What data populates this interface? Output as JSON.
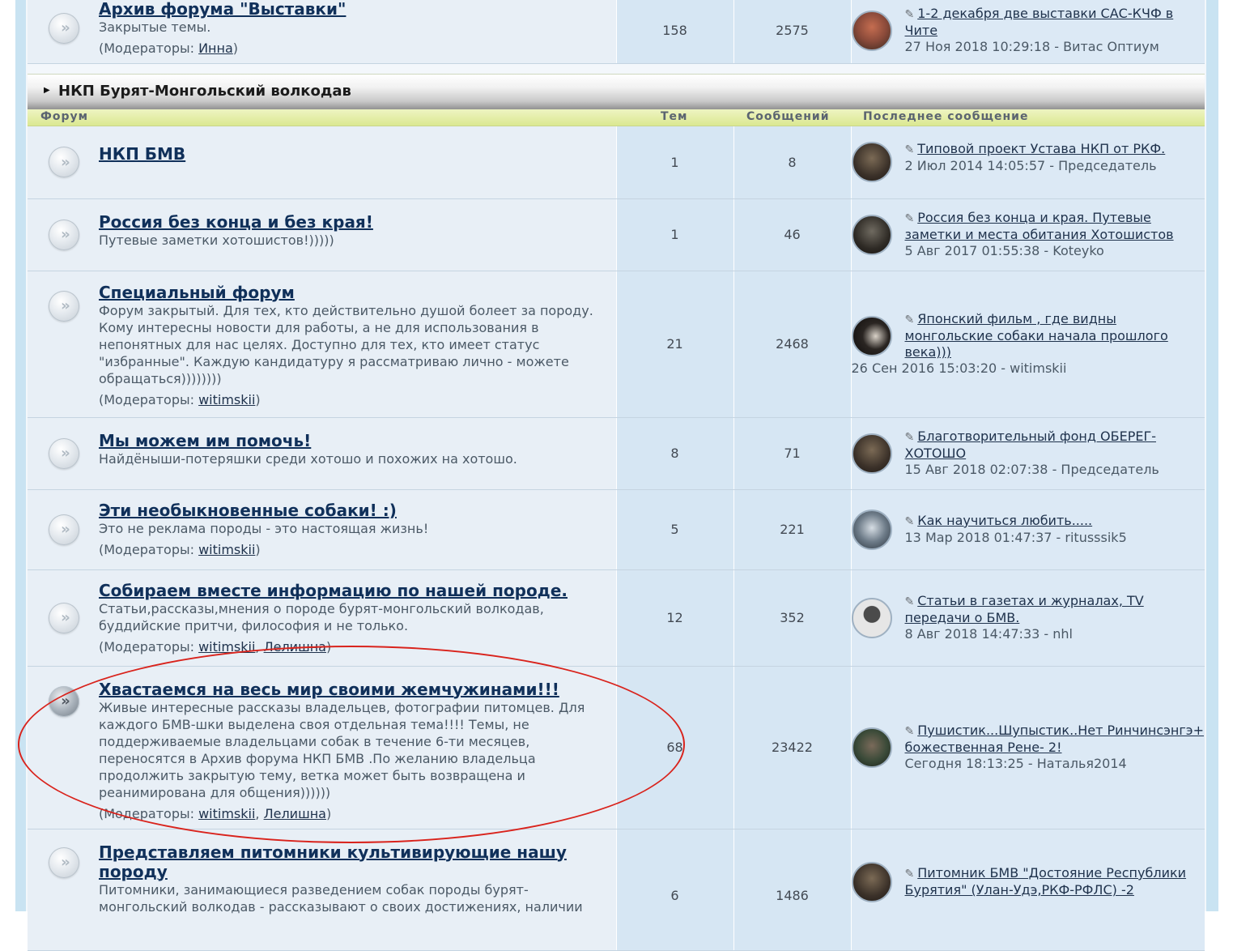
{
  "top_row": {
    "title": "Архив форума \"Выставки\"",
    "desc": "Закрытые темы.",
    "mods_prefix": "(Модераторы: ",
    "mods": [
      "Инна"
    ],
    "mods_suffix": ")",
    "topics": "158",
    "posts": "2575",
    "last_title": "1-2 декабря две выставки САС-КЧФ в Чите",
    "last_meta": "27 Ноя 2018 10:29:18 - Витас Оптиум"
  },
  "category": {
    "title": "НКП Бурят-Монгольский волкодав"
  },
  "columns": {
    "forum": "Форум",
    "topics": "Тем",
    "posts": "Сообщений",
    "last": "Последнее сообщение"
  },
  "forums": [
    {
      "title": "НКП БМВ",
      "desc": "",
      "mods": [],
      "topics": "1",
      "posts": "8",
      "last_title": "Типовой проект Устава НКП от РКФ.",
      "last_meta": "2 Июл 2014 14:05:57 - Председатель"
    },
    {
      "title": "Россия без конца и без края!",
      "desc": "Путевые заметки хотошистов!)))))",
      "mods": [],
      "topics": "1",
      "posts": "46",
      "last_title": "Россия без конца и края. Путевые заметки и места обитания Хотошистов",
      "last_meta": "5 Авг 2017 01:55:38 - Koteyko"
    },
    {
      "title": "Специальный форум",
      "desc": "Форум закрытый. Для тех, кто действительно душой болеет за породу. Кому интересны новости для работы, а не для использования в непонятных для нас целях. Доступно для тех, кто имеет статус \"избранные\". Каждую кандидатуру я рассматриваю лично - можете обращаться))))))))",
      "mods": [
        "witimskii"
      ],
      "topics": "21",
      "posts": "2468",
      "last_title": "Японский фильм , где видны монгольские собаки начала прошлого века)))",
      "last_meta": "26 Сен 2016 15:03:20 - witimskii"
    },
    {
      "title": "Мы можем им помочь!",
      "desc": "Найдёныши-потеряшки среди хотошо и похожих на хотошо.",
      "mods": [],
      "topics": "8",
      "posts": "71",
      "last_title": "Благотворительный фонд ОБЕРЕГ-ХОТОШО",
      "last_meta": "15 Авг 2018 02:07:38 - Председатель"
    },
    {
      "title": "Эти необыкновенные собаки! :)",
      "desc": "Это не реклама породы - это настоящая жизнь!",
      "mods": [
        "witimskii"
      ],
      "topics": "5",
      "posts": "221",
      "last_title": "Как научиться любить.....",
      "last_meta": "13 Мар 2018 01:47:37 - ritusssik5"
    },
    {
      "title": "Собираем вместе информацию по нашей породе.",
      "desc": "Статьи,рассказы,мнения о породе бурят-монгольский волкодав, буддийские притчи, философия и не только.",
      "mods": [
        "witimskii",
        "Лелишна"
      ],
      "topics": "12",
      "posts": "352",
      "last_title": "Статьи в газетах и журналах, TV передачи о БМВ.",
      "last_meta": "8 Авг 2018 14:47:33 - nhl"
    },
    {
      "title": "Хвастаемся на весь мир своими жемчужинами!!!",
      "desc": "Живые интересные рассказы владельцев, фотографии питомцев. Для каждого БМВ-шки выделена своя отдельная тема!!!! Темы, не поддерживаемые владельцами собак в течение 6-ти месяцев, переносятся в Архив форума НКП БМВ .По желанию владельца продолжить закрытую тему, ветка может быть возвращена и реанимирована для общения))))))",
      "mods": [
        "witimskii",
        "Лелишна"
      ],
      "topics": "68",
      "posts": "23422",
      "last_title": "Пушистик...Шупыстик..Нет Ринчинсэнгэ+ божественная Рене- 2!",
      "last_meta": "Сегодня 18:13:25 - Наталья2014"
    },
    {
      "title": "Представляем питомники культивирующие нашу породу",
      "desc": "Питомники, занимающиеся разведением собак породы бурят-монгольский волкодав - рассказывают о своих достижениях, наличии",
      "mods": [],
      "topics": "6",
      "posts": "1486",
      "last_title": "Питомник БМВ \"Достояние Республики Бурятия\" (Улан-Удэ,РКФ-РФЛС) -2",
      "last_meta": ""
    }
  ],
  "mods_prefix": "(Модераторы: ",
  "mods_sep": ", ",
  "mods_suffix": ")",
  "icon_glyph": "»",
  "pen_glyph": "✎"
}
